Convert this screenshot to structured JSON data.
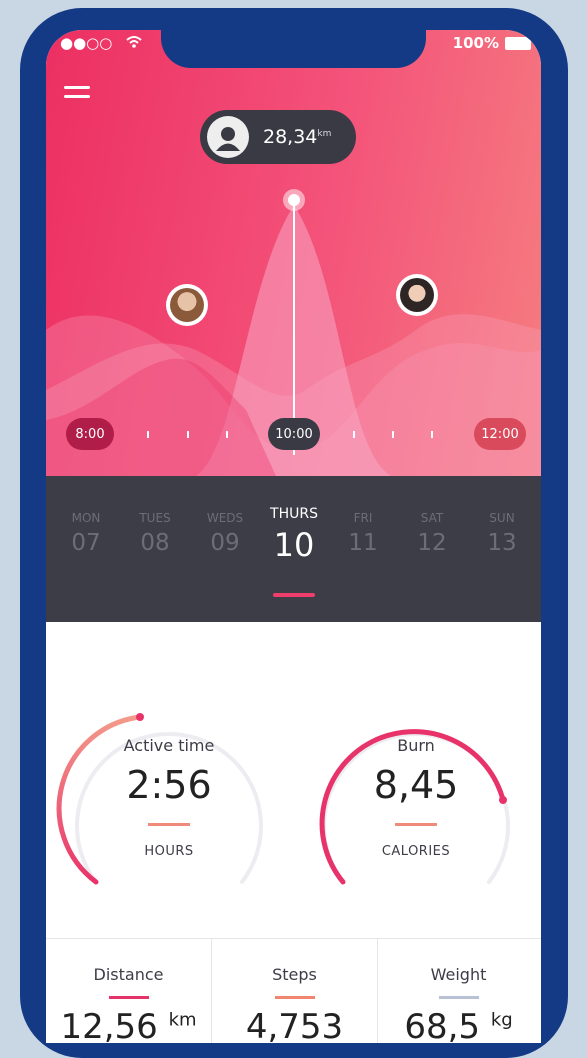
{
  "status": {
    "signal": "●●○○",
    "battery": "100%"
  },
  "hero": {
    "tooltip_value": "28,34",
    "tooltip_unit": "km",
    "times": {
      "start": "8:00",
      "current": "10:00",
      "end": "12:00"
    }
  },
  "days": [
    {
      "name": "MON",
      "date": "07"
    },
    {
      "name": "TUES",
      "date": "08"
    },
    {
      "name": "WEDS",
      "date": "09"
    },
    {
      "name": "THURS",
      "date": "10",
      "active": true
    },
    {
      "name": "FRI",
      "date": "11"
    },
    {
      "name": "SAT",
      "date": "12"
    },
    {
      "name": "SUN",
      "date": "13"
    }
  ],
  "stats": {
    "active": {
      "label": "Active time",
      "value": "2:56",
      "unit": "HOURS",
      "progress": 0.35
    },
    "burn": {
      "label": "Burn",
      "value": "8,45",
      "unit": "CALORIES",
      "progress": 0.62
    }
  },
  "cards": [
    {
      "label": "Distance",
      "value": "12,56",
      "unit": "km",
      "color": "#e8336a"
    },
    {
      "label": "Steps",
      "value": "4,753",
      "unit": "",
      "color": "#f0866f"
    },
    {
      "label": "Weight",
      "value": "68,5",
      "unit": "kg",
      "color": "#b9c2d4"
    }
  ],
  "colors": {
    "accent": "#ec2f62",
    "frame": "#143a86",
    "dark": "#3c3d47"
  }
}
